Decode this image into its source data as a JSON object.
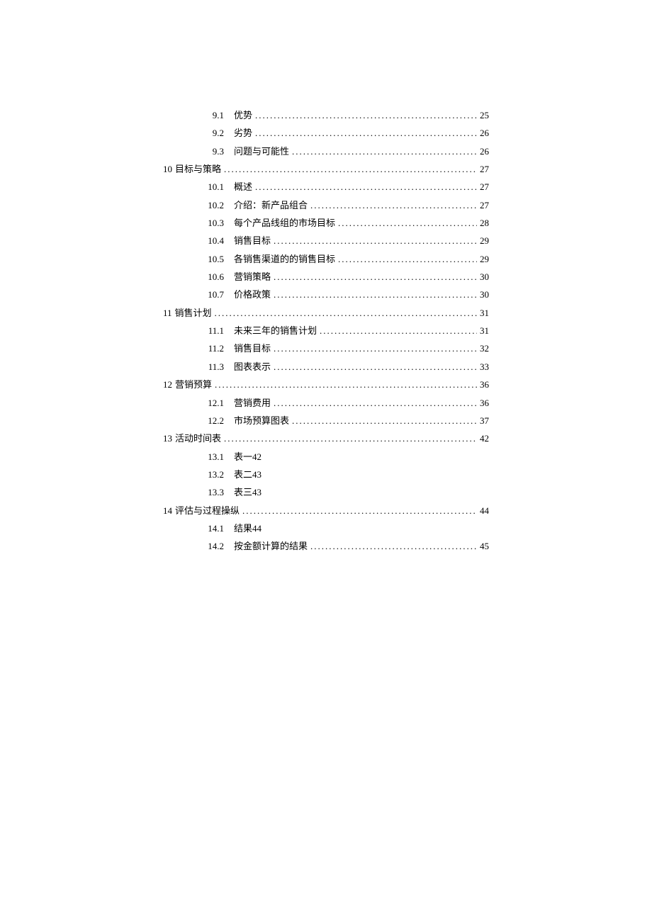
{
  "toc": [
    {
      "level": 2,
      "num": "9.1",
      "title": "优势",
      "page": "25",
      "leader": true
    },
    {
      "level": 2,
      "num": "9.2",
      "title": "劣势",
      "page": "26",
      "leader": true
    },
    {
      "level": 2,
      "num": "9.3",
      "title": "问题与可能性",
      "page": "26",
      "leader": true
    },
    {
      "level": 1,
      "num": "10",
      "title": "目标与策略",
      "page": "27",
      "leader": true
    },
    {
      "level": 2,
      "num": "10.1",
      "title": "概述",
      "page": "27",
      "leader": true
    },
    {
      "level": 2,
      "num": "10.2",
      "title": "介绍：新产品组合",
      "page": "27",
      "leader": true
    },
    {
      "level": 2,
      "num": "10.3",
      "title": "每个产品线组的市场目标",
      "page": "28",
      "leader": true
    },
    {
      "level": 2,
      "num": "10.4",
      "title": "销售目标",
      "page": "29",
      "leader": true
    },
    {
      "level": 2,
      "num": "10.5",
      "title": "各销售渠道的的销售目标",
      "page": "29",
      "leader": true
    },
    {
      "level": 2,
      "num": "10.6",
      "title": "营销策略",
      "page": "30",
      "leader": true
    },
    {
      "level": 2,
      "num": "10.7",
      "title": "价格政策",
      "page": "30",
      "leader": true
    },
    {
      "level": 1,
      "num": "11",
      "title": "销售计划",
      "page": "31",
      "leader": true
    },
    {
      "level": 2,
      "num": "11.1",
      "title": "未来三年的销售计划",
      "page": "31",
      "leader": true
    },
    {
      "level": 2,
      "num": "11.2",
      "title": "销售目标",
      "page": "32",
      "leader": true
    },
    {
      "level": 2,
      "num": "11.3",
      "title": "图表表示",
      "page": "33",
      "leader": true
    },
    {
      "level": 1,
      "num": "12",
      "title": "营销预算",
      "page": "36",
      "leader": true
    },
    {
      "level": 2,
      "num": "12.1",
      "title": "营销费用",
      "page": "36",
      "leader": true
    },
    {
      "level": 2,
      "num": "12.2",
      "title": "市场预算图表",
      "page": "37",
      "leader": true
    },
    {
      "level": 1,
      "num": "13",
      "title": "活动时间表",
      "page": "42",
      "leader": true
    },
    {
      "level": 2,
      "num": "13.1",
      "title": "表一",
      "page": "42",
      "leader": false
    },
    {
      "level": 2,
      "num": "13.2",
      "title": "表二",
      "page": "43",
      "leader": false
    },
    {
      "level": 2,
      "num": "13.3",
      "title": "表三",
      "page": "43",
      "leader": false
    },
    {
      "level": 1,
      "num": "14",
      "title": "评估与过程操纵",
      "page": "44",
      "leader": true
    },
    {
      "level": 2,
      "num": "14.1",
      "title": "结果",
      "page": "44",
      "leader": false
    },
    {
      "level": 2,
      "num": "14.2",
      "title": "按金额计算的结果",
      "page": "45",
      "leader": true
    }
  ]
}
